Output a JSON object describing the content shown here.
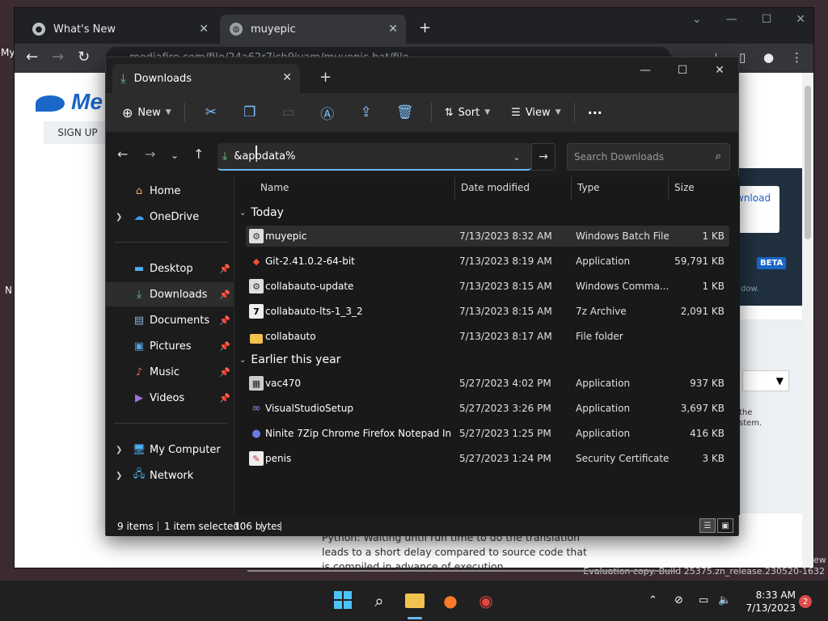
{
  "browser": {
    "tabs": [
      {
        "title": "What's New"
      },
      {
        "title": "muyepic"
      }
    ],
    "address_text": "mediafire.com/file/24a62r7ich9iyam/muyepic.bat/file",
    "page": {
      "logo_text": "Me",
      "signup_label": "SIGN UP",
      "download_label": "wnload",
      "beta_label": "BETA",
      "window_fragment": "dow.",
      "side_text_lines": [
        "the",
        "stem."
      ],
      "body_text": "Python: Waiting until run time to do the translation leads to a short delay compared to source code that is compiled in advance of execution.",
      "eval_text": "Evaluation copy. Build 25375.zn_release.230520-1632",
      "left_edge_text": "My",
      "left_edge_n": "N",
      "right_edge_text": "ew"
    }
  },
  "explorer": {
    "tab_title": "Downloads",
    "toolbar": {
      "new_label": "New",
      "sort_label": "Sort",
      "view_label": "View",
      "more_label": "···"
    },
    "address_value": "&appdata%",
    "search_placeholder": "Search Downloads",
    "nav": {
      "home": "Home",
      "onedrive": "OneDrive",
      "desktop": "Desktop",
      "downloads": "Downloads",
      "documents": "Documents",
      "pictures": "Pictures",
      "music": "Music",
      "videos": "Videos",
      "my_computer": "My Computer",
      "network": "Network"
    },
    "columns": {
      "name": "Name",
      "date": "Date modified",
      "type": "Type",
      "size": "Size"
    },
    "groups": {
      "today": "Today",
      "earlier": "Earlier this year"
    },
    "files": [
      {
        "name": "muyepic",
        "date": "7/13/2023 8:32 AM",
        "type": "Windows Batch File",
        "size": "1 KB"
      },
      {
        "name": "Git-2.41.0.2-64-bit",
        "date": "7/13/2023 8:19 AM",
        "type": "Application",
        "size": "59,791 KB"
      },
      {
        "name": "collabauto-update",
        "date": "7/13/2023 8:15 AM",
        "type": "Windows Comma...",
        "size": "1 KB"
      },
      {
        "name": "collabauto-lts-1_3_2",
        "date": "7/13/2023 8:15 AM",
        "type": "7z Archive",
        "size": "2,091 KB"
      },
      {
        "name": "collabauto",
        "date": "7/13/2023 8:17 AM",
        "type": "File folder",
        "size": ""
      },
      {
        "name": "vac470",
        "date": "5/27/2023 4:02 PM",
        "type": "Application",
        "size": "937 KB"
      },
      {
        "name": "VisualStudioSetup",
        "date": "5/27/2023 3:26 PM",
        "type": "Application",
        "size": "3,697 KB"
      },
      {
        "name": "Ninite 7Zip Chrome Firefox Notepad Inst...",
        "date": "5/27/2023 1:25 PM",
        "type": "Application",
        "size": "416 KB"
      },
      {
        "name": "penis",
        "date": "5/27/2023 1:24 PM",
        "type": "Security Certificate",
        "size": "3 KB"
      }
    ],
    "status": {
      "items": "9 items",
      "selected": "1 item selected",
      "bytes": "106 bytes"
    }
  },
  "taskbar": {
    "time": "8:33 AM",
    "date": "7/13/2023",
    "notification_count": "2"
  },
  "colors": {
    "accent": "#6cb8f0",
    "folder": "#f2c14e"
  }
}
